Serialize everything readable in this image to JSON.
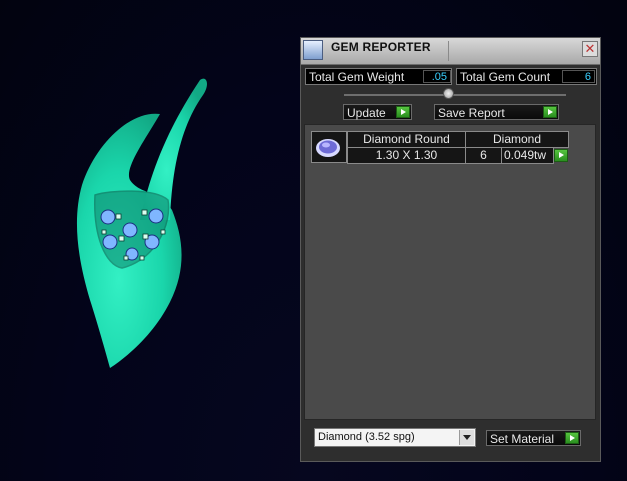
{
  "window": {
    "title": "GEM REPORTER",
    "close_glyph": "✕"
  },
  "stats": {
    "total_gem_weight_label": "Total Gem Weight",
    "total_gem_weight_value": ".05",
    "total_gem_count_label": "Total Gem Count",
    "total_gem_count_value": "6"
  },
  "toolbar": {
    "update_label": "Update",
    "save_report_label": "Save Report"
  },
  "gem_row": {
    "shape": "Diamond Round",
    "material": "Diamond",
    "size": "1.30 X 1.30",
    "count": "6",
    "weight": "0.049tw"
  },
  "material_select": {
    "value": "Diamond    (3.52 spg)"
  },
  "set_material_label": "Set Material",
  "icons": {
    "app": "gem-reporter-icon",
    "close": "close-icon",
    "go": "green-play-arrow-icon",
    "dropdown": "chevron-down-icon",
    "thumb": "round-diamond-icon"
  },
  "colors": {
    "jewel": "#1fe0b0",
    "stone": "#6aa3ff",
    "value_text": "#39d0ff",
    "go_button": "#3aa72c"
  }
}
